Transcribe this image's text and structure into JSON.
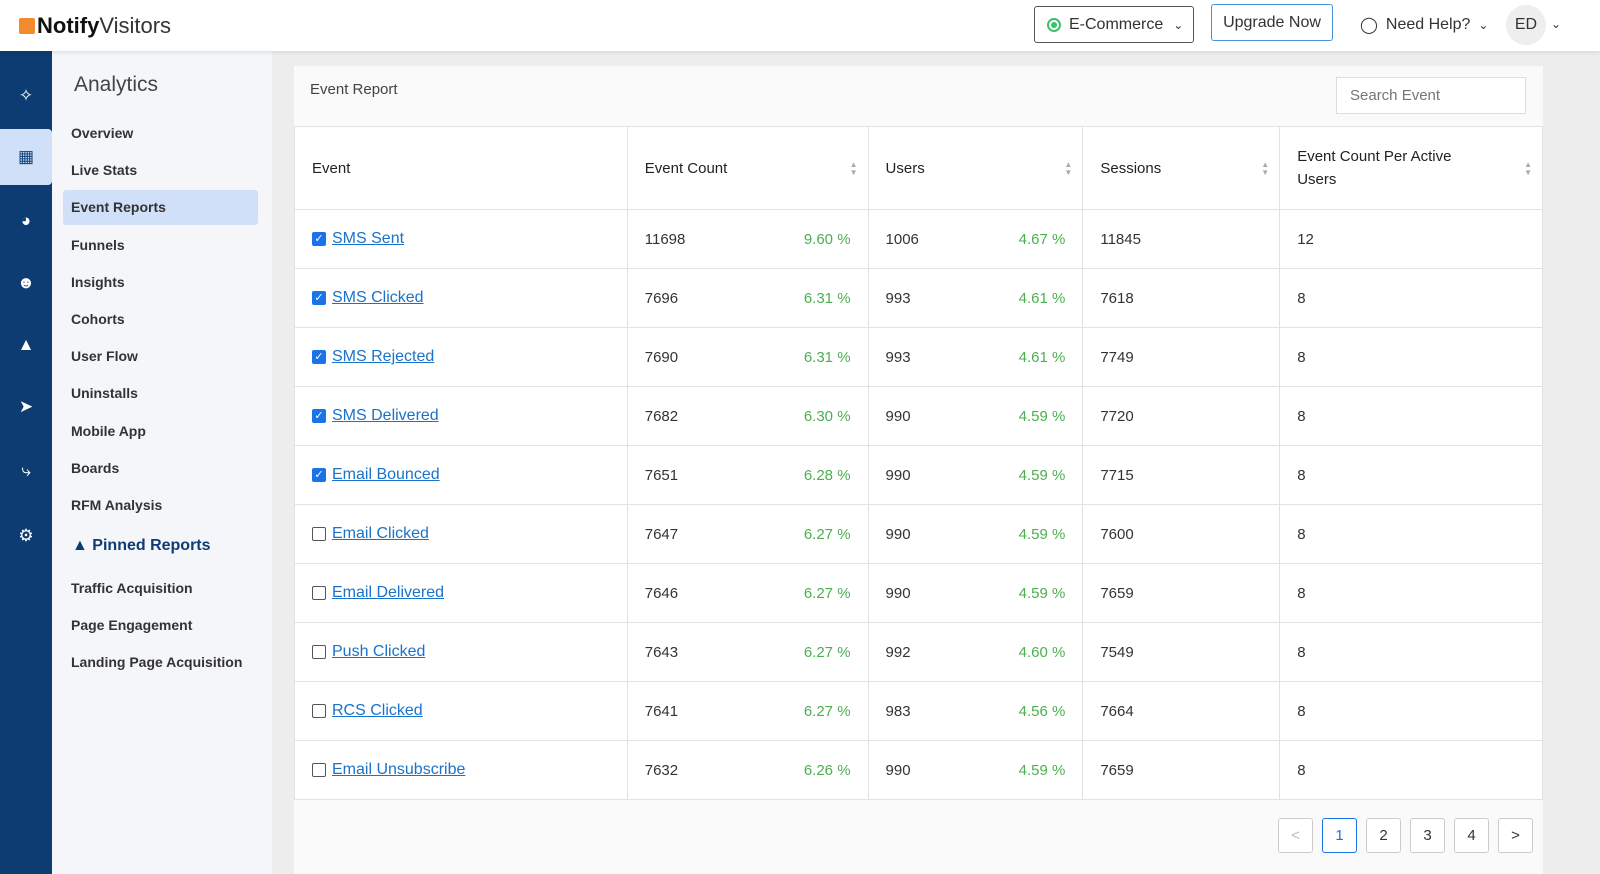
{
  "header": {
    "logo_bold": "Notify",
    "logo_light": "Visitors",
    "env": "E-Commerce",
    "upgrade": "Upgrade Now",
    "help": "Need Help?",
    "avatar": "ED"
  },
  "rail": [
    "sparkle-icon",
    "grid-icon",
    "dashboard-icon",
    "users-icon",
    "hierarchy-icon",
    "send-icon",
    "bolt-icon",
    "gear-icon"
  ],
  "nav": {
    "title": "Analytics",
    "items": [
      "Overview",
      "Live Stats",
      "Event Reports",
      "Funnels",
      "Insights",
      "Cohorts",
      "User Flow",
      "Uninstalls",
      "Mobile App",
      "Boards",
      "RFM Analysis"
    ],
    "pinned_title": "Pinned Reports",
    "pinned": [
      "Traffic Acquisition",
      "Page Engagement",
      "Landing Page Acquisition"
    ]
  },
  "report": {
    "title": "Event Report",
    "search_placeholder": "Search Event",
    "columns": [
      "Event",
      "Event Count",
      "Users",
      "Sessions",
      "Event Count Per Active Users"
    ],
    "rows": [
      {
        "checked": true,
        "event": "SMS Sent",
        "count": "11698",
        "count_pct": "9.60 %",
        "users": "1006",
        "users_pct": "4.67 %",
        "sessions": "11845",
        "per_user": "12"
      },
      {
        "checked": true,
        "event": "SMS Clicked",
        "count": "7696",
        "count_pct": "6.31 %",
        "users": "993",
        "users_pct": "4.61 %",
        "sessions": "7618",
        "per_user": "8"
      },
      {
        "checked": true,
        "event": "SMS Rejected",
        "count": "7690",
        "count_pct": "6.31 %",
        "users": "993",
        "users_pct": "4.61 %",
        "sessions": "7749",
        "per_user": "8"
      },
      {
        "checked": true,
        "event": "SMS Delivered",
        "count": "7682",
        "count_pct": "6.30 %",
        "users": "990",
        "users_pct": "4.59 %",
        "sessions": "7720",
        "per_user": "8"
      },
      {
        "checked": true,
        "event": "Email Bounced",
        "count": "7651",
        "count_pct": "6.28 %",
        "users": "990",
        "users_pct": "4.59 %",
        "sessions": "7715",
        "per_user": "8"
      },
      {
        "checked": false,
        "event": "Email Clicked",
        "count": "7647",
        "count_pct": "6.27 %",
        "users": "990",
        "users_pct": "4.59 %",
        "sessions": "7600",
        "per_user": "8"
      },
      {
        "checked": false,
        "event": "Email Delivered",
        "count": "7646",
        "count_pct": "6.27 %",
        "users": "990",
        "users_pct": "4.59 %",
        "sessions": "7659",
        "per_user": "8"
      },
      {
        "checked": false,
        "event": "Push Clicked",
        "count": "7643",
        "count_pct": "6.27 %",
        "users": "992",
        "users_pct": "4.60 %",
        "sessions": "7549",
        "per_user": "8"
      },
      {
        "checked": false,
        "event": "RCS Clicked",
        "count": "7641",
        "count_pct": "6.27 %",
        "users": "983",
        "users_pct": "4.56 %",
        "sessions": "7664",
        "per_user": "8"
      },
      {
        "checked": false,
        "event": "Email Unsubscribe",
        "count": "7632",
        "count_pct": "6.26 %",
        "users": "990",
        "users_pct": "4.59 %",
        "sessions": "7659",
        "per_user": "8"
      }
    ]
  },
  "pagination": {
    "prev": "<",
    "pages": [
      "1",
      "2",
      "3",
      "4"
    ],
    "current": "1",
    "next": ">"
  }
}
